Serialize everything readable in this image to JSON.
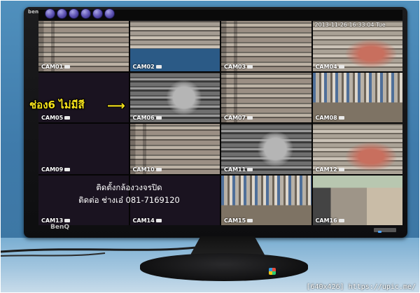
{
  "monitor": {
    "brand_top": "benq",
    "brand_bottom": "BenQ"
  },
  "dvr": {
    "timestamp": "2013-11-26 16:33:04 Tue",
    "toolbar_icons": [
      "user-icon",
      "menu-icon",
      "record-icon",
      "playback-icon",
      "lock-icon",
      "monitor-icon"
    ],
    "tiles": [
      {
        "label": "CAM01",
        "style": "shop"
      },
      {
        "label": "CAM02",
        "style": "blue"
      },
      {
        "label": "CAM03",
        "style": "shop"
      },
      {
        "label": "CAM04",
        "style": "red"
      },
      {
        "label": "CAM05",
        "style": "empty"
      },
      {
        "label": "CAM06",
        "style": "dark"
      },
      {
        "label": "CAM07",
        "style": "shop"
      },
      {
        "label": "CAM08",
        "style": "mixed"
      },
      {
        "label": "CAM09",
        "style": "empty"
      },
      {
        "label": "CAM10",
        "style": "shop"
      },
      {
        "label": "CAM11",
        "style": "dark"
      },
      {
        "label": "CAM12",
        "style": "red"
      },
      {
        "label": "CAM13",
        "style": "info"
      },
      {
        "label": "CAM14",
        "style": "info"
      },
      {
        "label": "CAM15",
        "style": "mixed"
      },
      {
        "label": "CAM16",
        "style": "street"
      }
    ],
    "info_lines": [
      "ติดตั้งกล้องวงจรปิด",
      "ติดต่อ ช่างเอ๋ 081-7169120"
    ]
  },
  "annotation": {
    "text": "ช่อง6 ไม่มีสี",
    "arrow": "⟶"
  },
  "watermark": "[640x426] https://upic.me/"
}
